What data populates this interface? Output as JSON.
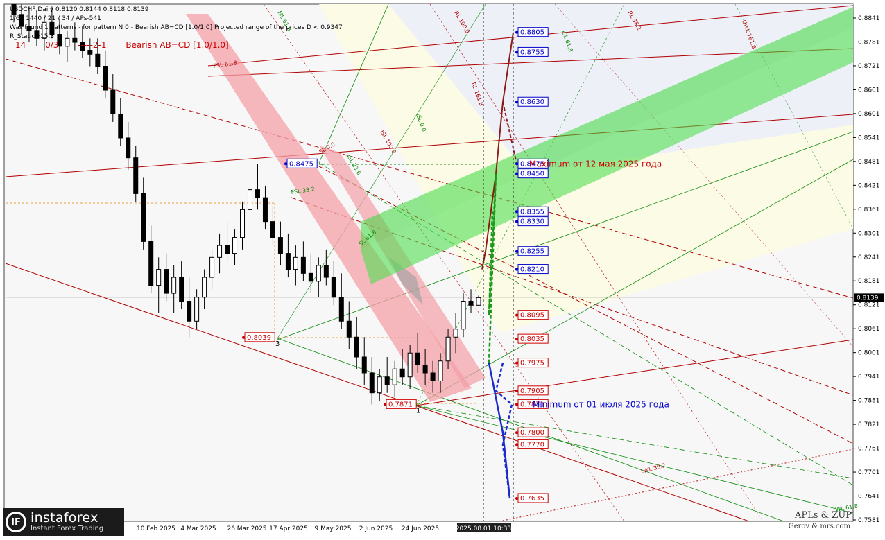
{
  "header": {
    "line1": "USDCHF,Daily  0.8120 0.8144 0.8118 0.8139",
    "line2": "1/6 / 1440 / 21 / 34 / APs-541",
    "line3": "Was found 1 patterns  -  for pattern N 0 - Bearish AB=CD [1.0/1.0] Projected range of the prices D < 0.9347",
    "line4": "R_Static=15.3",
    "pattern_status": [
      "14",
      "0/3",
      "-----2-1",
      "Bearish AB=CD [1.0/1.0]"
    ]
  },
  "logo": {
    "title": "instaforex",
    "subtitle": "Instant Forex Trading",
    "mark": "IF"
  },
  "signature": {
    "line1": "APLs & ZUP",
    "line2": "Gerov & mrs.com"
  },
  "colors": {
    "upper_channel": "#3ad83a",
    "pink_band": "#f4a0a8",
    "red_line": "#b00000",
    "green_line": "#0b8a0b",
    "blue_label": "#0000cc",
    "red_label": "#cc0000"
  },
  "chart_data": {
    "type": "candlestick",
    "symbol": "USDCHF",
    "timeframe": "Daily",
    "ylim": [
      0.7581,
      0.8841
    ],
    "current_price": "0.8139",
    "y_ticks": [
      "0.8841",
      "0.8781",
      "0.8721",
      "0.8661",
      "0.8601",
      "0.8541",
      "0.8481",
      "0.8421",
      "0.8361",
      "0.8301",
      "0.8241",
      "0.8181",
      "0.8121",
      "0.8061",
      "0.8001",
      "0.7941",
      "0.7881",
      "0.7821",
      "0.7761",
      "0.7701",
      "0.7641",
      "0.7581"
    ],
    "x_ticks": [
      "10 Feb 2025",
      "4 Mar 2025",
      "26 Mar 2025",
      "17 Apr 2025",
      "9 May 2025",
      "2 Jun 2025",
      "24 Jun 2025",
      "2025.08.01 10:33"
    ],
    "target_levels_blue": [
      "0.8805",
      "0.8755",
      "0.8630",
      "0.8475",
      "0.8450",
      "0.8355",
      "0.8330",
      "0.8255",
      "0.8210"
    ],
    "target_levels_red": [
      "0.8095",
      "0.8035",
      "0.7975",
      "0.7905",
      "0.7871",
      "0.7800",
      "0.7770",
      "0.7635"
    ],
    "pivot_labels": [
      {
        "text": "0.8475",
        "kind": "blue",
        "point": "B"
      },
      {
        "text": "0.8039",
        "kind": "red",
        "point": "3"
      },
      {
        "text": "0.7871",
        "kind": "red",
        "point": "1"
      }
    ],
    "pivot_numbers": [
      "3",
      "1"
    ],
    "annotations": [
      {
        "text": "Maximum от 12 мая 2025 года",
        "price": 0.8475,
        "color": "#cc0000"
      },
      {
        "text": "Minimum от 01 июля 2025 года",
        "price": 0.7871,
        "color": "#0000cc"
      }
    ],
    "fib_labels": [
      "FSL 61.8",
      "FSL 38.2",
      "SL 0.0",
      "SL 61.8",
      "RL 161.8",
      "ISL 0.0",
      "ISL 100.0",
      "ISL 23.6",
      "LWL 38.2",
      "WL 61.8",
      "UWL 161.8",
      "ML 61.8",
      "RL 100.0",
      "ISL 61.8",
      "RL 38.2"
    ],
    "series": [
      {
        "name": "candles",
        "values": [
          [
            0.888,
            0.892,
            0.883,
            0.885
          ],
          [
            0.885,
            0.89,
            0.88,
            0.882
          ],
          [
            0.882,
            0.887,
            0.878,
            0.881
          ],
          [
            0.881,
            0.886,
            0.877,
            0.879
          ],
          [
            0.879,
            0.885,
            0.876,
            0.883
          ],
          [
            0.883,
            0.887,
            0.879,
            0.88
          ],
          [
            0.88,
            0.884,
            0.875,
            0.877
          ],
          [
            0.877,
            0.881,
            0.873,
            0.879
          ],
          [
            0.879,
            0.883,
            0.876,
            0.878
          ],
          [
            0.878,
            0.882,
            0.874,
            0.876
          ],
          [
            0.876,
            0.879,
            0.872,
            0.875
          ],
          [
            0.875,
            0.879,
            0.87,
            0.872
          ],
          [
            0.872,
            0.876,
            0.864,
            0.866
          ],
          [
            0.866,
            0.87,
            0.858,
            0.86
          ],
          [
            0.86,
            0.864,
            0.852,
            0.854
          ],
          [
            0.854,
            0.858,
            0.846,
            0.849
          ],
          [
            0.849,
            0.852,
            0.838,
            0.84
          ],
          [
            0.84,
            0.844,
            0.826,
            0.828
          ],
          [
            0.828,
            0.832,
            0.815,
            0.817
          ],
          [
            0.817,
            0.824,
            0.81,
            0.821
          ],
          [
            0.821,
            0.825,
            0.813,
            0.815
          ],
          [
            0.815,
            0.822,
            0.81,
            0.819
          ],
          [
            0.819,
            0.823,
            0.811,
            0.813
          ],
          [
            0.813,
            0.819,
            0.8039,
            0.808
          ],
          [
            0.808,
            0.816,
            0.806,
            0.814
          ],
          [
            0.814,
            0.821,
            0.811,
            0.819
          ],
          [
            0.819,
            0.826,
            0.816,
            0.824
          ],
          [
            0.824,
            0.83,
            0.82,
            0.827
          ],
          [
            0.827,
            0.833,
            0.823,
            0.825
          ],
          [
            0.825,
            0.831,
            0.822,
            0.829
          ],
          [
            0.829,
            0.838,
            0.826,
            0.836
          ],
          [
            0.836,
            0.844,
            0.832,
            0.841
          ],
          [
            0.841,
            0.8475,
            0.836,
            0.839
          ],
          [
            0.839,
            0.842,
            0.831,
            0.833
          ],
          [
            0.833,
            0.837,
            0.827,
            0.829
          ],
          [
            0.829,
            0.833,
            0.822,
            0.825
          ],
          [
            0.825,
            0.83,
            0.819,
            0.821
          ],
          [
            0.821,
            0.827,
            0.817,
            0.824
          ],
          [
            0.824,
            0.828,
            0.818,
            0.82
          ],
          [
            0.82,
            0.825,
            0.815,
            0.818
          ],
          [
            0.818,
            0.824,
            0.814,
            0.822
          ],
          [
            0.822,
            0.826,
            0.817,
            0.819
          ],
          [
            0.819,
            0.823,
            0.812,
            0.814
          ],
          [
            0.814,
            0.82,
            0.806,
            0.808
          ],
          [
            0.808,
            0.813,
            0.801,
            0.804
          ],
          [
            0.804,
            0.809,
            0.796,
            0.799
          ],
          [
            0.799,
            0.804,
            0.792,
            0.795
          ],
          [
            0.795,
            0.799,
            0.7871,
            0.79
          ],
          [
            0.79,
            0.796,
            0.788,
            0.794
          ],
          [
            0.794,
            0.799,
            0.79,
            0.792
          ],
          [
            0.792,
            0.798,
            0.789,
            0.796
          ],
          [
            0.796,
            0.801,
            0.792,
            0.794
          ],
          [
            0.794,
            0.802,
            0.791,
            0.8
          ],
          [
            0.8,
            0.805,
            0.795,
            0.797
          ],
          [
            0.797,
            0.801,
            0.792,
            0.795
          ],
          [
            0.795,
            0.798,
            0.79,
            0.793
          ],
          [
            0.793,
            0.8,
            0.79,
            0.798
          ],
          [
            0.798,
            0.806,
            0.796,
            0.804
          ],
          [
            0.804,
            0.81,
            0.8,
            0.806
          ],
          [
            0.806,
            0.815,
            0.804,
            0.813
          ],
          [
            0.813,
            0.816,
            0.81,
            0.812
          ],
          [
            0.812,
            0.8144,
            0.8118,
            0.8139
          ]
        ]
      }
    ]
  }
}
